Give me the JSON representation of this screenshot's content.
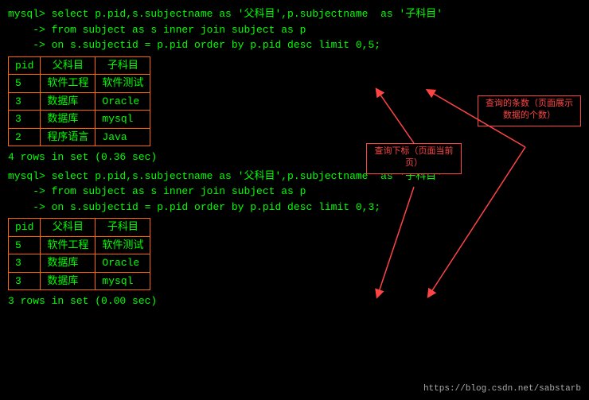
{
  "terminal": {
    "background": "#000000",
    "text_color": "#00ff00"
  },
  "query1": {
    "line1": "mysql> select p.pid,s.subjectname as '父科目',p.subjectname  as '子科目'",
    "line2": "    -> from subject as s inner join subject as p",
    "line3": "    -> on s.subjectid = p.pid order by p.pid desc limit 0,5;",
    "table": {
      "headers": [
        "pid",
        "父科目",
        "子科目"
      ],
      "rows": [
        [
          "5",
          "软件工程",
          "软件测试"
        ],
        [
          "3",
          "数据库",
          "Oracle"
        ],
        [
          "3",
          "数据库",
          "mysql"
        ],
        [
          "2",
          "程序语言",
          "Java"
        ]
      ]
    },
    "result": "4 rows in set (0.36 sec)"
  },
  "query2": {
    "line1": "mysql> select p.pid,s.subjectname as '父科目',p.subjectname  as '子科目'",
    "line2": "    -> from subject as s inner join subject as p",
    "line3": "    -> on s.subjectid = p.pid order by p.pid desc limit 0,3;",
    "table": {
      "headers": [
        "pid",
        "父科目",
        "子科目"
      ],
      "rows": [
        [
          "5",
          "软件工程",
          "软件测试"
        ],
        [
          "3",
          "数据库",
          "Oracle"
        ],
        [
          "3",
          "数据库",
          "mysql"
        ]
      ]
    },
    "result": "3 rows in set (0.00 sec)"
  },
  "annotations": {
    "left_label": "查询下标（页面当前页）",
    "right_label_line1": "查询的条数（页面",
    "right_label_line2": "展示数据的个数）"
  },
  "watermark": "https://blog.csdn.net/sabstarb"
}
